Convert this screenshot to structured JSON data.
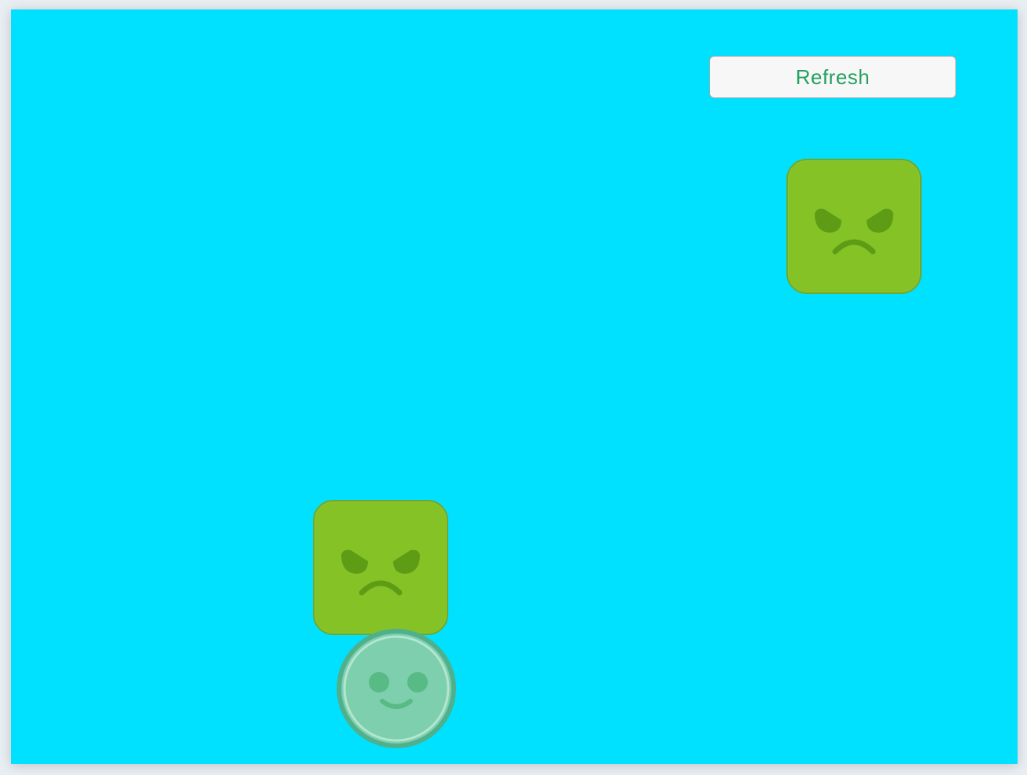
{
  "toolbar": {
    "refresh_label": "Refresh"
  },
  "colors": {
    "background": "#00e1ff",
    "enemy_fill": "#85c226",
    "enemy_feature": "#5f9c16",
    "player_fill": "#7ecfad",
    "player_ring": "#4fb08e",
    "player_feature": "#58ba84",
    "button_text": "#25a05f"
  },
  "sprites": {
    "enemies": [
      {
        "name": "angry-block-1",
        "icon": "angry-face-icon"
      },
      {
        "name": "angry-block-2",
        "icon": "angry-face-icon"
      }
    ],
    "player": {
      "name": "player-ball",
      "icon": "smiley-face-icon"
    }
  }
}
